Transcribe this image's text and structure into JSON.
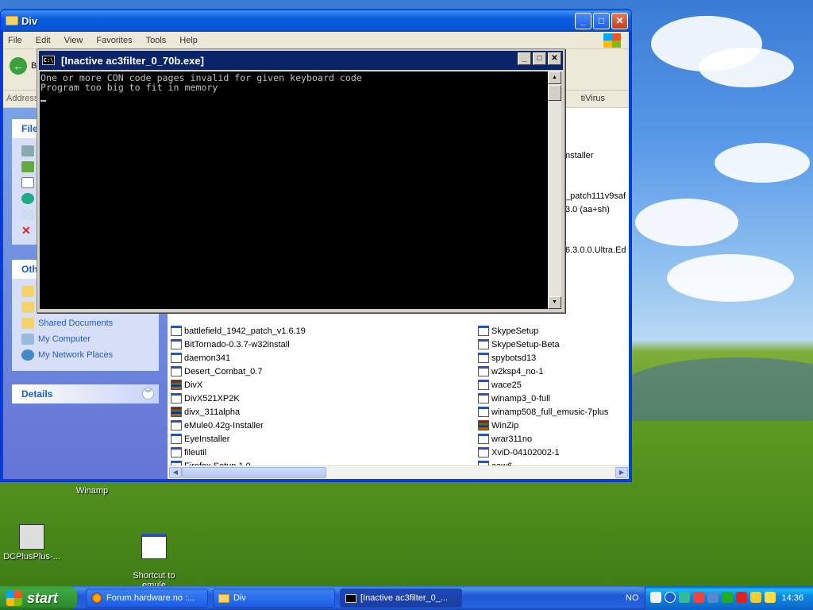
{
  "explorer": {
    "title": "Div",
    "menu": [
      "File",
      "Edit",
      "View",
      "Favorites",
      "Tools",
      "Help"
    ],
    "back_label": "B",
    "address_label": "Address",
    "address_right": "tiVirus",
    "taskpane": {
      "file_tasks_header": "File",
      "other_places_header": "Oth",
      "other_places_items": [
        "Shared Documents",
        "My Computer",
        "My Network Places"
      ],
      "details_header": "Details"
    },
    "partial_names": [
      "nstaller",
      "_patch111v9saf",
      "3.0 (aa+sh)",
      "6.3.0.0.Ultra.Ed"
    ],
    "files_col1": [
      {
        "name": "battlefield_1942_patch_v1.6.19",
        "icon": "exe"
      },
      {
        "name": "BitTornado-0.3.7-w32install",
        "icon": "exe"
      },
      {
        "name": "daemon341",
        "icon": "exe"
      },
      {
        "name": "Desert_Combat_0.7",
        "icon": "exe"
      },
      {
        "name": "DivX",
        "icon": "rar"
      },
      {
        "name": "DivX521XP2K",
        "icon": "exe"
      },
      {
        "name": "divx_311alpha",
        "icon": "rar"
      },
      {
        "name": "eMule0.42g-Installer",
        "icon": "exe"
      },
      {
        "name": "EyeInstaller",
        "icon": "exe"
      },
      {
        "name": "fileutil",
        "icon": "exe"
      },
      {
        "name": "Firefox Setup 1.0",
        "icon": "exe"
      }
    ],
    "files_col2": [
      {
        "name": "SkypeSetup",
        "icon": "exe"
      },
      {
        "name": "SkypeSetup-Beta",
        "icon": "exe"
      },
      {
        "name": "spybotsd13",
        "icon": "exe"
      },
      {
        "name": "w2ksp4_no-1",
        "icon": "exe"
      },
      {
        "name": "wace25",
        "icon": "exe"
      },
      {
        "name": "winamp3_0-full",
        "icon": "exe"
      },
      {
        "name": "winamp508_full_emusic-7plus",
        "icon": "exe"
      },
      {
        "name": "WinZip",
        "icon": "rar"
      },
      {
        "name": "wrar311no",
        "icon": "exe"
      },
      {
        "name": "XviD-04102002-1",
        "icon": "exe"
      },
      {
        "name": "aaw6",
        "icon": "exe"
      }
    ]
  },
  "console": {
    "title": "[Inactive ac3filter_0_70b.exe]",
    "icon_text": "C:\\",
    "lines": [
      "One or more CON code pages invalid for given keyboard code",
      "Program too big to fit in memory"
    ]
  },
  "desktop_icons": [
    {
      "label": "Winamp"
    },
    {
      "label": "DCPlusPlus-..."
    },
    {
      "label": "Shortcut to\nemule"
    }
  ],
  "taskbar": {
    "start_label": "start",
    "buttons": [
      {
        "label": "Forum.hardware.no :...",
        "icon": "firefox-icon"
      },
      {
        "label": "Div",
        "icon": "folder-icon"
      },
      {
        "label": "[Inactive ac3filter_0_...",
        "icon": "cmd-icon"
      }
    ],
    "language": "NO",
    "clock": "14:36"
  }
}
